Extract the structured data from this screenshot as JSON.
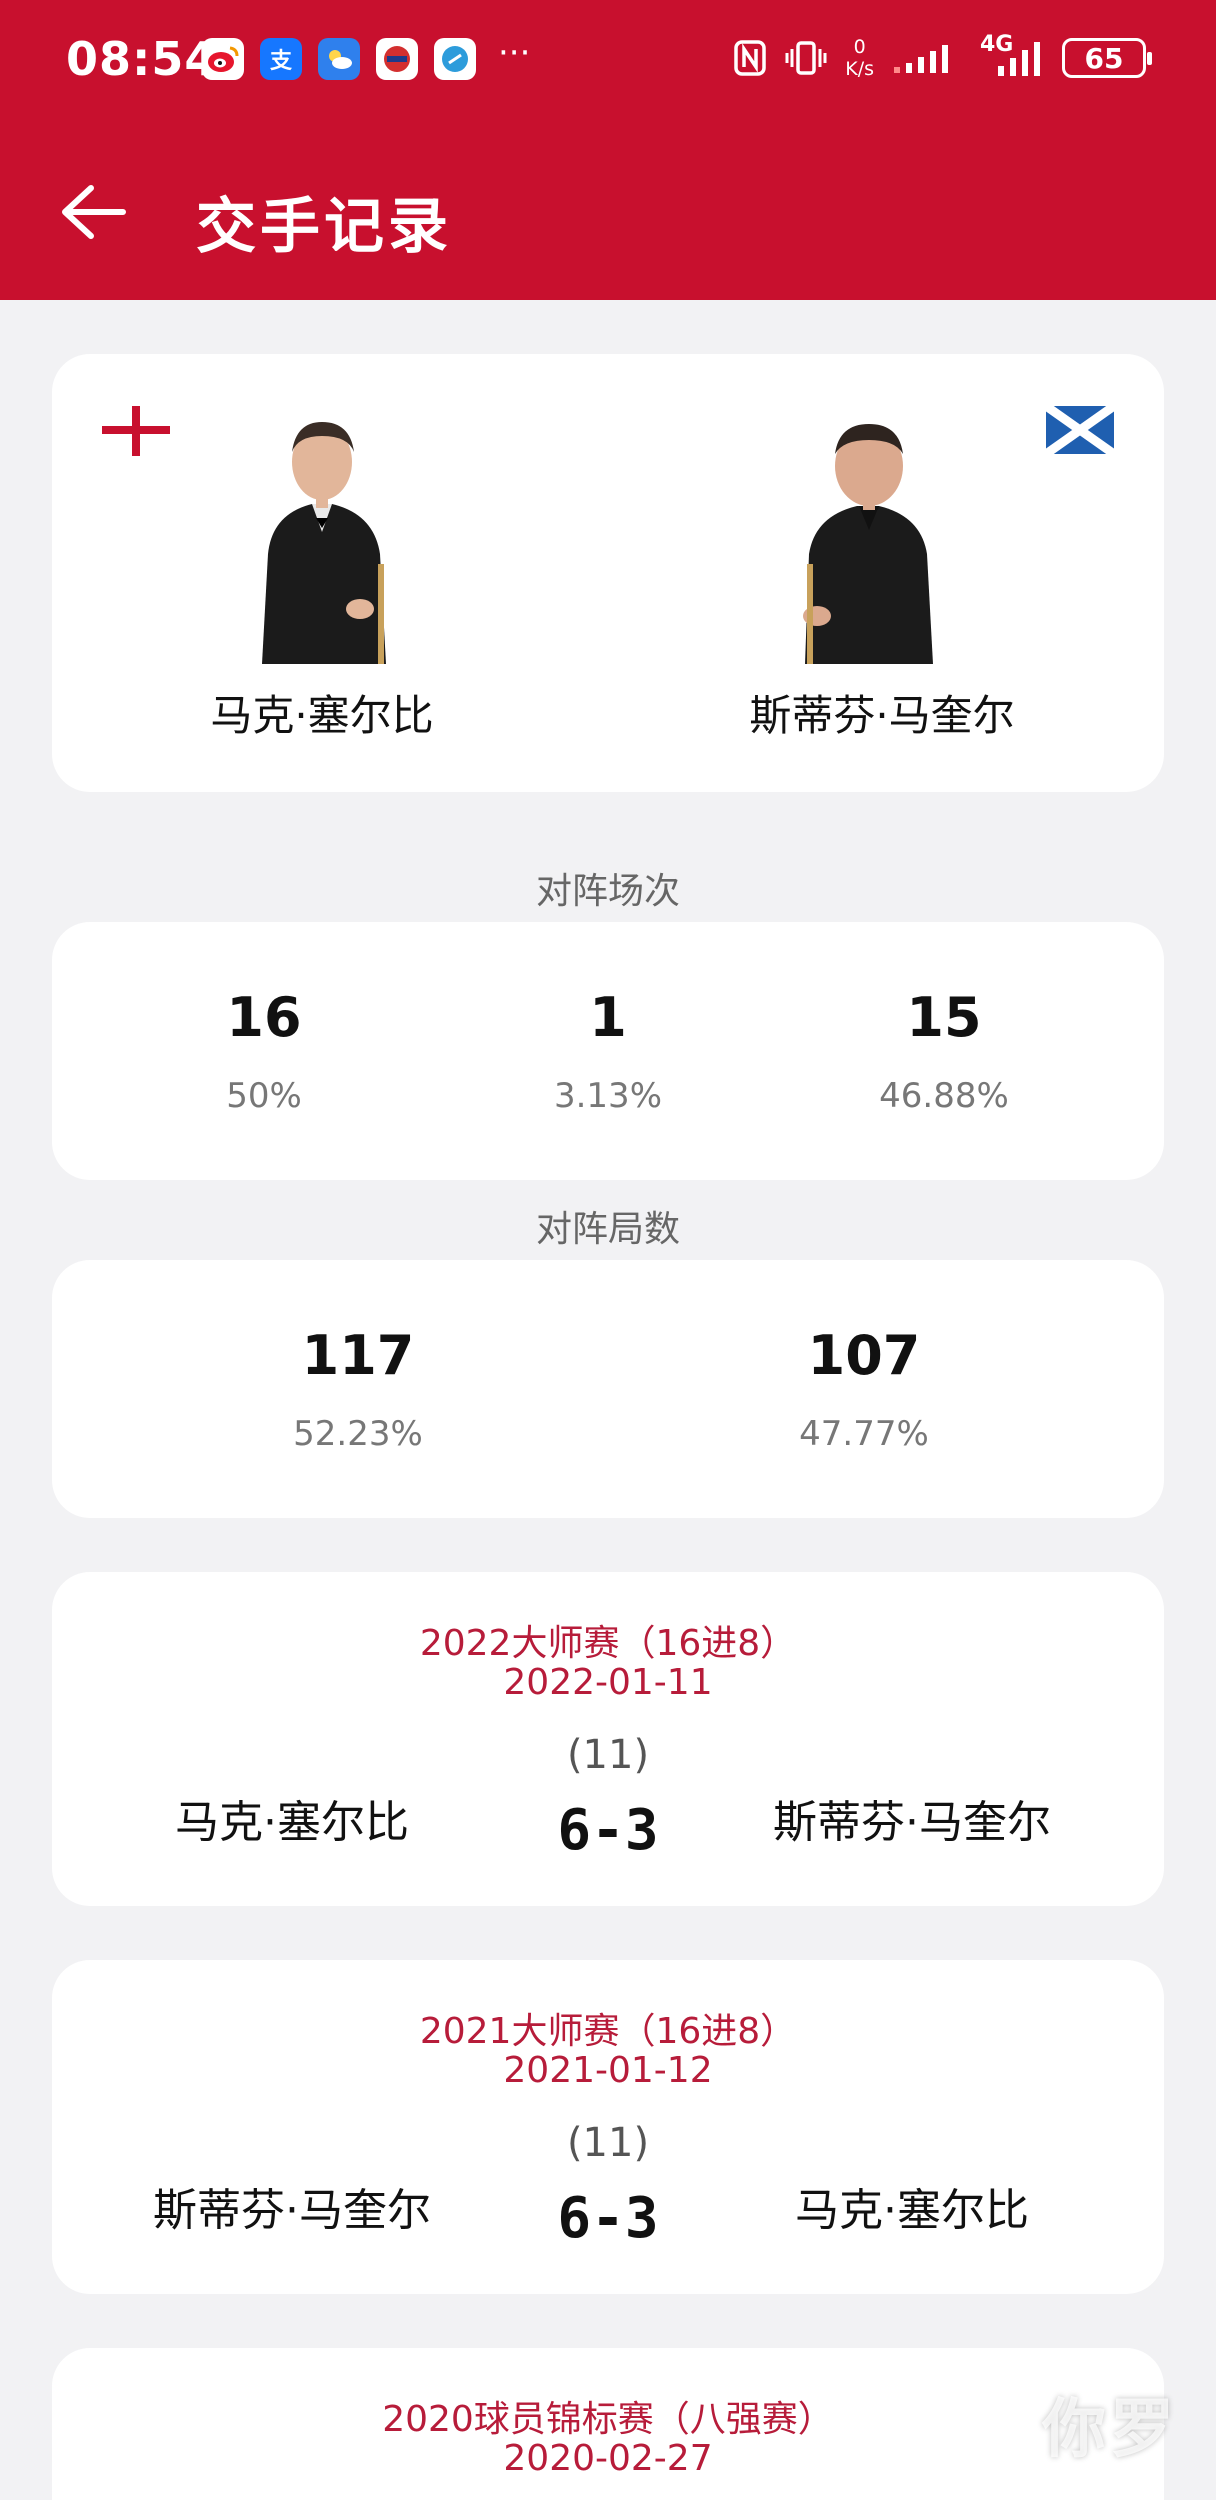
{
  "status_bar": {
    "time": "08:54",
    "apps": [
      "weibo-icon",
      "alipay-icon",
      "weather-icon",
      "news-icon",
      "browser-icon"
    ],
    "more": "···",
    "net_speed_value": "0",
    "net_speed_unit": "K/s",
    "network_type": "4G",
    "battery": "65"
  },
  "header": {
    "title": "交手记录"
  },
  "players": {
    "left": {
      "name": "马克·塞尔比",
      "flag": "england-flag-icon"
    },
    "right": {
      "name": "斯蒂芬·马奎尔",
      "flag": "scotland-flag-icon"
    }
  },
  "matches_section": {
    "label": "对阵场次",
    "left_wins": "16",
    "left_pct": "50%",
    "draws": "1",
    "draws_pct": "3.13%",
    "right_wins": "15",
    "right_pct": "46.88%"
  },
  "frames_section": {
    "label": "对阵局数",
    "left_frames": "117",
    "left_pct": "52.23%",
    "right_frames": "107",
    "right_pct": "47.77%"
  },
  "matches": [
    {
      "title": "2022大师赛（16进8）",
      "date": "2022-01-11",
      "frames": "(11)",
      "left": "马克·塞尔比",
      "score": "6-3",
      "right": "斯蒂芬·马奎尔"
    },
    {
      "title": "2021大师赛（16进8）",
      "date": "2021-01-12",
      "frames": "(11)",
      "left": "斯蒂芬·马奎尔",
      "score": "6-3",
      "right": "马克·塞尔比"
    },
    {
      "title": "2020球员锦标赛（八强赛）",
      "date": "2020-02-27"
    }
  ],
  "watermark": "你罗",
  "colors": {
    "brand_red": "#c8102e",
    "match_title": "#b71c3a",
    "background": "#f2f2f4"
  }
}
